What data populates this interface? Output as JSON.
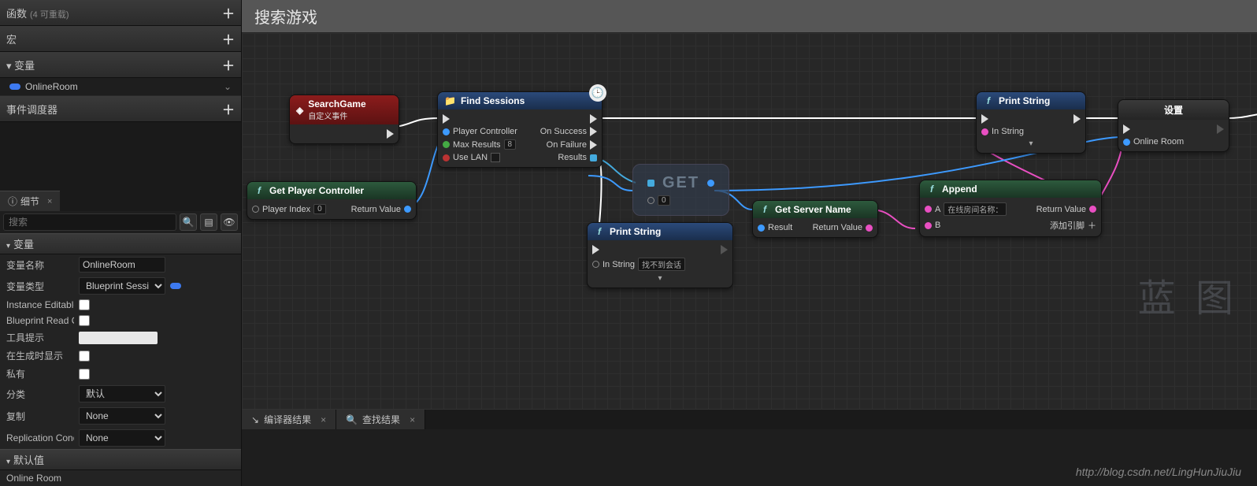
{
  "sidebar": {
    "functions": {
      "label": "函数",
      "hint": "(4 可重载)"
    },
    "macros": {
      "label": "宏"
    },
    "variables": {
      "label": "变量",
      "items": [
        {
          "name": "OnlineRoom"
        }
      ]
    },
    "dispatchers": {
      "label": "事件调度器"
    }
  },
  "detail": {
    "tab": "细节",
    "search_placeholder": "搜索",
    "cat_var": "变量",
    "rows": {
      "name_label": "变量名称",
      "name_value": "OnlineRoom",
      "type_label": "变量类型",
      "type_value": "Blueprint Sessi",
      "editable_label": "Instance Editable",
      "readonly_label": "Blueprint Read O",
      "tooltip_label": "工具提示",
      "spawn_label": "在生成时显示",
      "private_label": "私有",
      "category_label": "分类",
      "category_value": "默认",
      "replication_label": "复制",
      "replication_value": "None",
      "repcond_label": "Replication Cond",
      "repcond_value": "None"
    },
    "cat_default": "默认值",
    "default_item": "Online Room"
  },
  "graph": {
    "title": "搜索游戏",
    "watermark": "蓝 图",
    "nodes": {
      "search_game": {
        "title": "SearchGame",
        "subtitle": "自定义事件"
      },
      "find_sessions": {
        "title": "Find Sessions",
        "player_controller": "Player Controller",
        "max_results": "Max Results",
        "max_results_val": "8",
        "use_lan": "Use LAN",
        "on_success": "On Success",
        "on_failure": "On Failure",
        "results": "Results"
      },
      "get_pc": {
        "title": "Get Player Controller",
        "player_index": "Player Index",
        "player_index_val": "0",
        "return": "Return Value"
      },
      "get": {
        "label": "GET",
        "idx": "0"
      },
      "print1": {
        "title": "Print String",
        "in_string": "In String",
        "in_string_val": "找不到会话"
      },
      "get_server": {
        "title": "Get Server Name",
        "result": "Result",
        "return": "Return Value"
      },
      "append": {
        "title": "Append",
        "a": "A",
        "a_val": "在线房间名称：",
        "b": "B",
        "return": "Return Value",
        "add_pin": "添加引脚"
      },
      "print2": {
        "title": "Print String",
        "in_string": "In String"
      },
      "set": {
        "title": "设置",
        "var": "Online Room"
      }
    }
  },
  "bottom": {
    "compiler": "编译器结果",
    "find": "查找结果"
  },
  "url": "http://blog.csdn.net/LingHunJiuJiu"
}
